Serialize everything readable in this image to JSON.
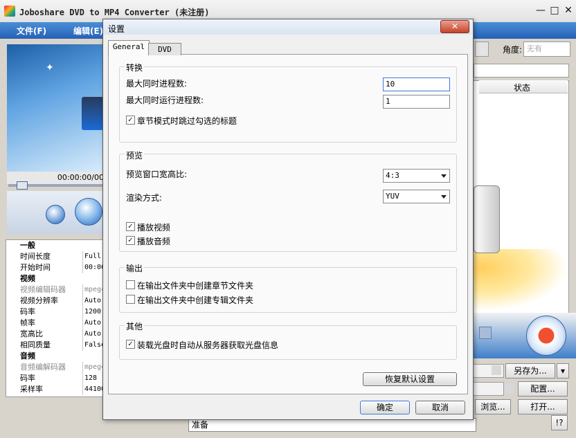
{
  "app": {
    "title": "Joboshare DVD to MP4 Converter (未注册)",
    "close_glyph": "✕",
    "min_glyph": "—",
    "max_glyph": "□",
    "menu": [
      "文件(F)",
      "编辑(E)"
    ]
  },
  "player": {
    "time": "00:00:00/00"
  },
  "props": {
    "groups": [
      {
        "label": "一般",
        "rows": [
          {
            "name": "时间长度",
            "value": "Full",
            "disabled": false
          },
          {
            "name": "开始时间",
            "value": "00:00",
            "disabled": false
          }
        ]
      },
      {
        "label": "视频",
        "rows": [
          {
            "name": "视频编辑码器",
            "value": "mpeg4",
            "disabled": true
          },
          {
            "name": "视频分辨率",
            "value": "Auto",
            "disabled": false
          },
          {
            "name": "码率",
            "value": "1200",
            "disabled": false
          },
          {
            "name": "帧率",
            "value": "Auto",
            "disabled": false
          },
          {
            "name": "宽高比",
            "value": "Auto",
            "disabled": false
          },
          {
            "name": "相同质量",
            "value": "False",
            "disabled": false
          }
        ]
      },
      {
        "label": "音频",
        "rows": [
          {
            "name": "音频编解码器",
            "value": "mpeg4",
            "disabled": true
          },
          {
            "name": "码率",
            "value": "128",
            "disabled": false
          },
          {
            "name": "采样率",
            "value": "44100",
            "disabled": false
          }
        ]
      }
    ]
  },
  "status_text": "准备",
  "right": {
    "angle_label": "角度:",
    "angle_value": "无有",
    "state_header": "状态",
    "save_as": "另存为...",
    "config": "配置...",
    "browse": "浏览...",
    "open": "打开...",
    "help": "!?"
  },
  "dialog": {
    "title": "设置",
    "close_glyph": "✕",
    "tabs": [
      "General",
      "DVD"
    ],
    "convert": {
      "title": "转换",
      "max_processes_label": "最大同时进程数:",
      "max_processes_value": "10",
      "max_running_label": "最大同时运行进程数:",
      "max_running_value": "1",
      "skip_checked_label": "章节模式时跳过勾选的标题",
      "skip_checked": true
    },
    "preview": {
      "title": "预览",
      "aspect_label": "预览窗口宽高比:",
      "aspect_value": "4:3",
      "render_label": "渲染方式:",
      "render_value": "YUV",
      "play_video_label": "播放视频",
      "play_video": true,
      "play_audio_label": "播放音频",
      "play_audio": true
    },
    "output": {
      "title": "输出",
      "chapter_folder_label": "在输出文件夹中创建章节文件夹",
      "chapter_folder": false,
      "album_folder_label": "在输出文件夹中创建专辑文件夹",
      "album_folder": false
    },
    "other": {
      "title": "其他",
      "fetch_info_label": "装载光盘时自动从服务器获取光盘信息",
      "fetch_info": true
    },
    "restore_label": "恢复默认设置",
    "ok_label": "确定",
    "cancel_label": "取消"
  }
}
